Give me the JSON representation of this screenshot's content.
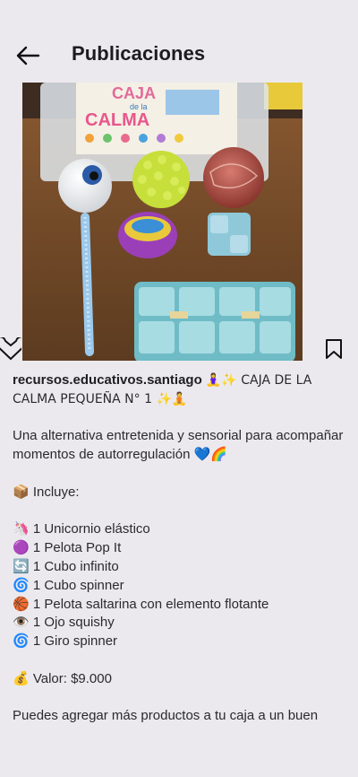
{
  "header": {
    "title": "Publicaciones"
  },
  "post": {
    "username": "recursos.educativos.santiago",
    "headline": "🧘‍♀️✨ CAJA DE LA CALMA PEQUEÑA N° 1 ✨🧘",
    "photo_box_text_1": "CAJA",
    "photo_box_text_2": "de la",
    "photo_box_text_3": "CALMA",
    "intro": "Una alternativa entretenida y sensorial para acompañar momentos de autorregulación 💙🌈",
    "includes_label": "📦 Incluye:",
    "items": [
      "🦄 1 Unicornio elástico",
      "🟣 1 Pelota Pop It",
      "🔄 1 Cubo infinito",
      "🌀 1 Cubo spinner",
      "🏀 1 Pelota saltarina con elemento flotante",
      "👁️ 1 Ojo squishy",
      "🌀 1 Giro spinner"
    ],
    "price": "💰 Valor: $9.000",
    "footer_text": "Puedes agregar más productos a tu caja a un buen"
  },
  "icons": {
    "back": "arrow-left-icon",
    "like": "heart-icon",
    "save": "bookmark-icon"
  }
}
